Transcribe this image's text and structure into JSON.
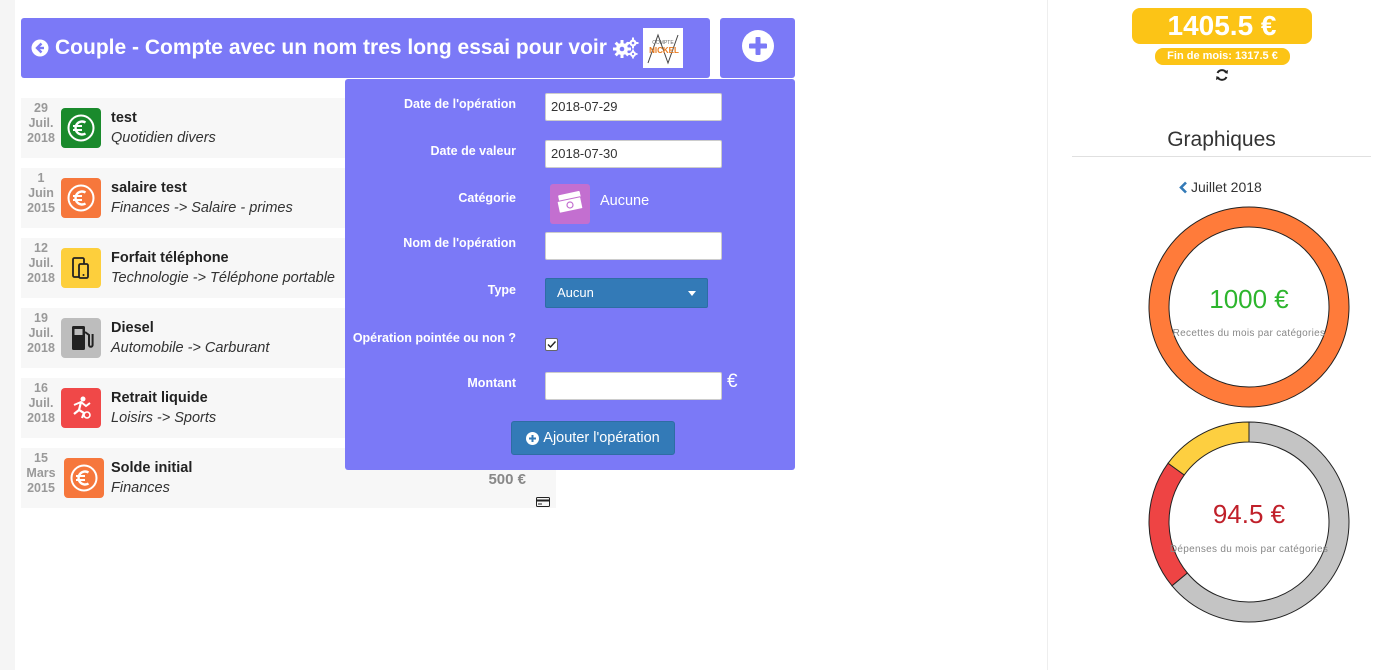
{
  "header": {
    "title": "Couple - Compte avec un nom tres long essai pour voir",
    "bank_logo_line1": "COMPTE",
    "bank_logo_line2": "NICKEL"
  },
  "operations": [
    {
      "day": "29",
      "month": "Juil.",
      "year": "2018",
      "name": "test",
      "category": "Quotidien divers",
      "icon": "euro-icon",
      "color": "#1a8a2c",
      "amount": ""
    },
    {
      "day": "1",
      "month": "Juin",
      "year": "2015",
      "name": "salaire test",
      "category": "Finances -> Salaire - primes",
      "icon": "euro-icon",
      "color": "#f6773c",
      "amount": ""
    },
    {
      "day": "12",
      "month": "Juil.",
      "year": "2018",
      "name": "Forfait téléphone",
      "category": "Technologie -> Téléphone portable",
      "icon": "phone-icon",
      "color": "#fdcf3c",
      "amount": ""
    },
    {
      "day": "19",
      "month": "Juil.",
      "year": "2018",
      "name": "Diesel",
      "category": "Automobile -> Carburant",
      "icon": "fuel-pump-icon",
      "color": "#bdbdbd",
      "amount": ""
    },
    {
      "day": "16",
      "month": "Juil.",
      "year": "2018",
      "name": "Retrait liquide",
      "category": "Loisirs -> Sports",
      "icon": "skater-icon",
      "color": "#f04848",
      "amount": ""
    },
    {
      "day": "15",
      "month": "Mars",
      "year": "2015",
      "name": "Solde initial",
      "category": "Finances",
      "icon": "euro-icon",
      "color": "#f6773c",
      "amount": "500 €"
    }
  ],
  "form": {
    "date_operation_label": "Date de l'opération",
    "date_operation_value": "2018-07-29",
    "date_valeur_label": "Date de valeur",
    "date_valeur_value": "2018-07-30",
    "categorie_label": "Catégorie",
    "categorie_value": "Aucune",
    "nom_label": "Nom de l'opération",
    "nom_value": "",
    "type_label": "Type",
    "type_value": "Aucun",
    "pointee_label": "Opération pointée ou non ?",
    "pointee_checked": true,
    "montant_label": "Montant",
    "montant_value": "",
    "currency": "€",
    "submit_label": "Ajouter l'opération"
  },
  "summary": {
    "balance": "1405.5 €",
    "end_of_month": "Fin de mois: 1317.5 €"
  },
  "graphs": {
    "title": "Graphiques",
    "month": "Juillet 2018",
    "income": {
      "value": "1000 €",
      "caption": "Recettes du mois par catégories",
      "value_color": "#2db52d",
      "segments": [
        {
          "share": 1.0,
          "color": "#ff7b3a"
        }
      ]
    },
    "expenses": {
      "value": "94.5 €",
      "caption": "Dépenses du mois par catégories",
      "value_color": "#c0202a",
      "segments": [
        {
          "share": 0.64,
          "color": "#c4c4c4"
        },
        {
          "share": 0.21,
          "color": "#ee4444"
        },
        {
          "share": 0.15,
          "color": "#fdcf40"
        }
      ]
    }
  }
}
